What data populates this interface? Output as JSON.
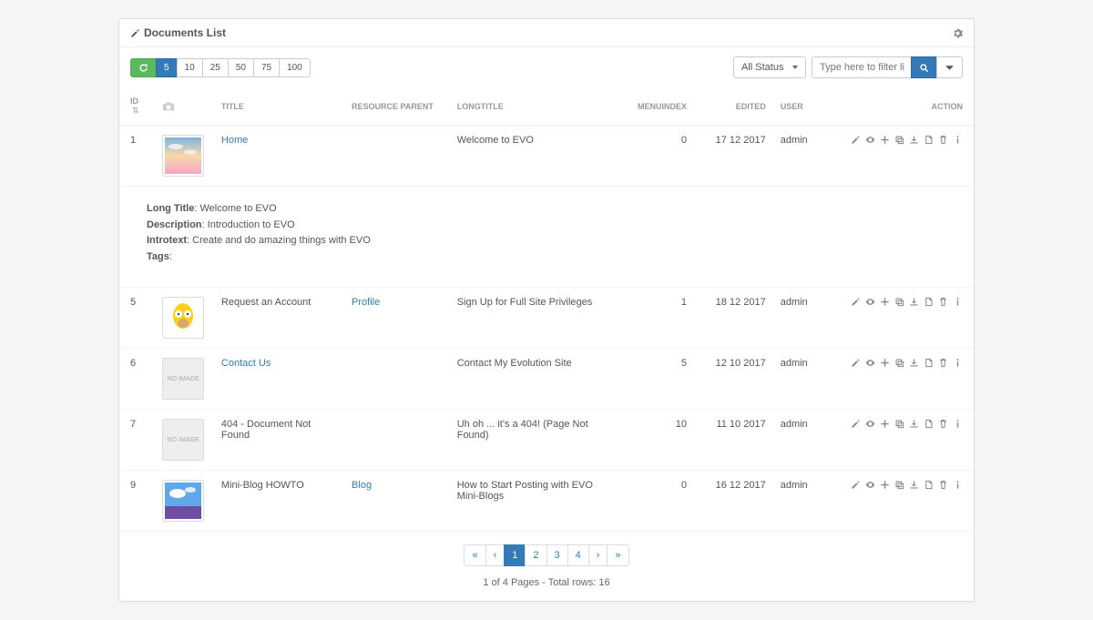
{
  "panel_title": "Documents List",
  "page_sizes": [
    "5",
    "10",
    "25",
    "50",
    "75",
    "100"
  ],
  "page_size_active": "5",
  "status_filter": "All Status",
  "filter_placeholder": "Type here to filter list",
  "columns": {
    "id": "ID",
    "title": "TITLE",
    "parent": "RESOURCE PARENT",
    "longtitle": "LONGTITLE",
    "menuindex": "MENUINDEX",
    "edited": "EDITED",
    "user": "USER",
    "action": "ACTION"
  },
  "rows": [
    {
      "id": "1",
      "title": "Home",
      "title_link": true,
      "parent": "",
      "longtitle": "Welcome to EVO",
      "menuindex": "0",
      "edited": "17 12 2017",
      "user": "admin",
      "thumb": "sky"
    },
    {
      "id": "5",
      "title": "Request an Account",
      "title_link": false,
      "parent": "Profile",
      "parent_link": true,
      "longtitle": "Sign Up for Full Site Privileges",
      "menuindex": "1",
      "edited": "18 12 2017",
      "user": "admin",
      "thumb": "homer"
    },
    {
      "id": "6",
      "title": "Contact Us",
      "title_link": true,
      "parent": "",
      "longtitle": "Contact My Evolution Site",
      "menuindex": "5",
      "edited": "12 10 2017",
      "user": "admin",
      "thumb": "placeholder"
    },
    {
      "id": "7",
      "title": "404 - Document Not Found",
      "title_link": false,
      "parent": "",
      "longtitle": "Uh oh ... it's a 404! (Page Not Found)",
      "menuindex": "10",
      "edited": "11 10 2017",
      "user": "admin",
      "thumb": "placeholder"
    },
    {
      "id": "9",
      "title": "Mini-Blog HOWTO",
      "title_link": false,
      "parent": "Blog",
      "parent_link": true,
      "longtitle": "How to Start Posting with EVO Mini-Blogs",
      "menuindex": "0",
      "edited": "16 12 2017",
      "user": "admin",
      "thumb": "landscape"
    }
  ],
  "expanded_detail": {
    "long_title_label": "Long Title",
    "long_title_value": "Welcome to EVO",
    "description_label": "Description",
    "description_value": "Introduction to EVO",
    "introtext_label": "Introtext",
    "introtext_value": "Create and do amazing things with EVO",
    "tags_label": "Tags",
    "tags_value": ""
  },
  "pagination": {
    "pages": [
      "1",
      "2",
      "3",
      "4"
    ],
    "active": "1",
    "info": "1 of 4 Pages - Total rows: 16"
  }
}
